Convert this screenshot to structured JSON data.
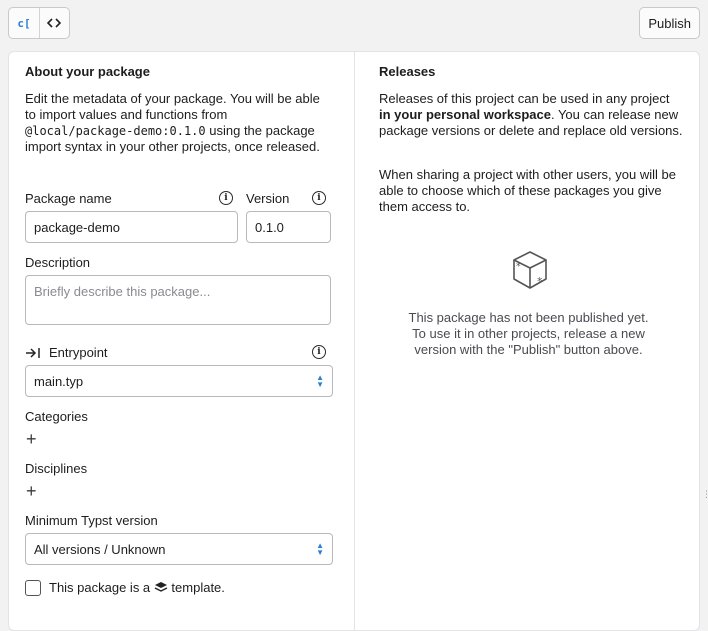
{
  "toolbar": {
    "seg_left_label": "c[",
    "seg_right_icon": "code-icon",
    "publish_label": "Publish"
  },
  "about": {
    "title": "About your package",
    "desc_part1": "Edit the metadata of your package. You will be able to import values and functions from",
    "import_path": "@local/package-demo:0.1.0",
    "desc_part2": "using the package import syntax in your other projects, once released."
  },
  "form": {
    "name_label": "Package name",
    "name_value": "package-demo",
    "version_label": "Version",
    "version_value": "0.1.0",
    "description_label": "Description",
    "description_placeholder": "Briefly describe this package...",
    "entrypoint_label": "Entrypoint",
    "entrypoint_value": "main.typ",
    "categories_label": "Categories",
    "disciplines_label": "Disciplines",
    "min_version_label": "Minimum Typst version",
    "min_version_value": "All versions / Unknown",
    "template_prefix": "This package is a",
    "template_suffix": "template."
  },
  "releases": {
    "title": "Releases",
    "p1_part1": "Releases of this project can be used in any project",
    "p1_bold": "in your personal workspace",
    "p1_part2": ". You can release new package versions or delete and replace old versions.",
    "p2": "When sharing a project with other users, you will be able to choose which of these packages you give them access to.",
    "empty_line1": "This package has not been published yet.",
    "empty_line2": "To use it in other projects, release a new",
    "empty_line3": "version with the \"Publish\" button above."
  }
}
